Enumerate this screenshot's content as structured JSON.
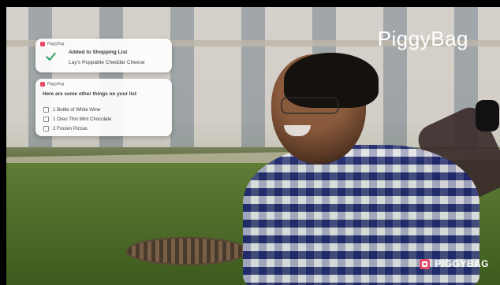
{
  "brand": {
    "top_text": "PiggyBag",
    "bottom_text": "PIGGYBAG",
    "accent": "#e84a6a"
  },
  "notification_added": {
    "app_name": "PiggyBag",
    "title": "Added to Shopping List",
    "item": "Lay's Poppable Cheddar Cheese",
    "icon": "checkmark-icon"
  },
  "notification_list": {
    "app_name": "PiggyBag",
    "title": "Here are some other things on your list",
    "items": [
      {
        "label": "1 Bottle of White Wine"
      },
      {
        "label": "1 Oreo Thin Mint Chocolate"
      },
      {
        "label": "2 Frozen Pizzas"
      }
    ]
  }
}
